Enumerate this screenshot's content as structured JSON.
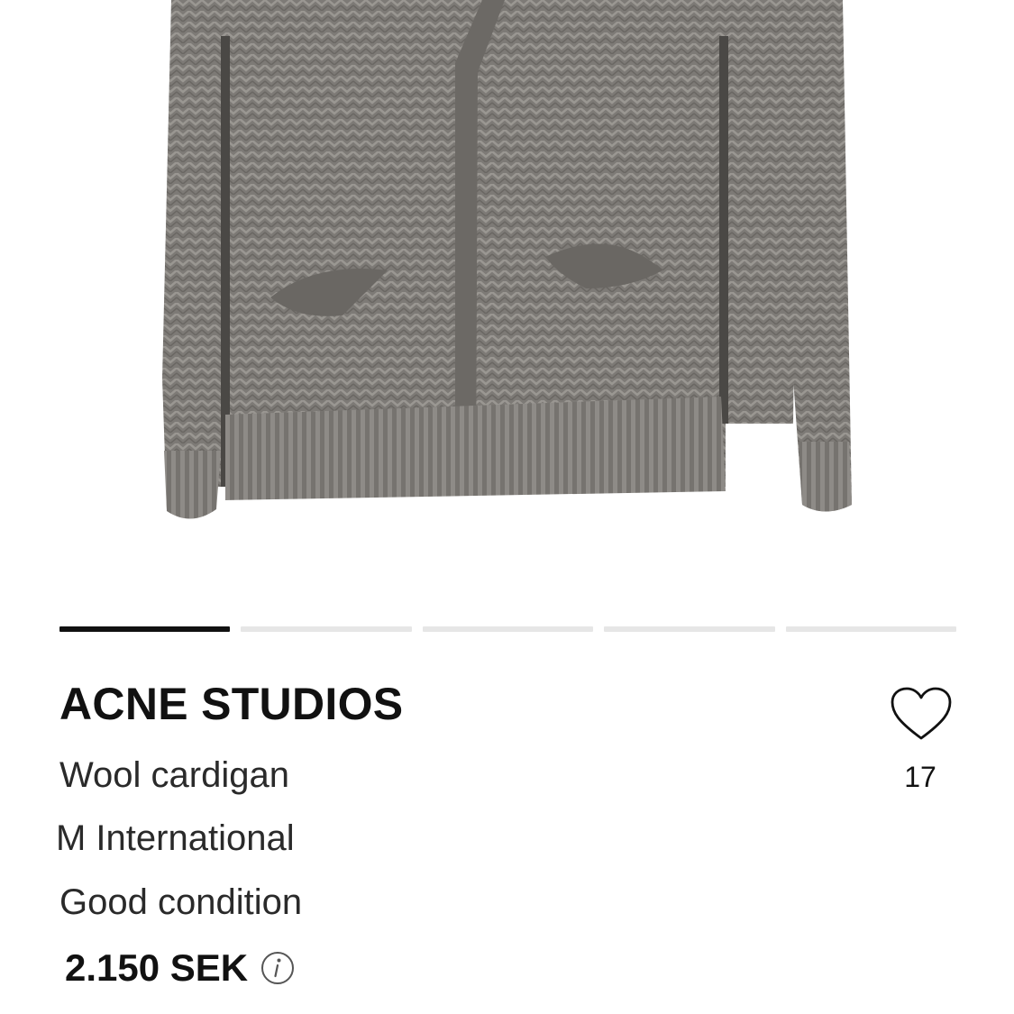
{
  "product": {
    "brand": "ACNE STUDIOS",
    "title": "Wool cardigan",
    "size": "M International",
    "condition": "Good condition",
    "price": "2.150 SEK",
    "favorites_count": "17"
  },
  "carousel": {
    "total": 5,
    "active_index": 1
  },
  "icons": {
    "favorite": "heart-outline-icon",
    "price_info": "info-icon"
  },
  "colors": {
    "text": "#111111",
    "secondary_text": "#2a2a2a",
    "indicator_active": "#111111",
    "indicator_inactive": "#e6e6e6",
    "garment": "#7a7773"
  }
}
